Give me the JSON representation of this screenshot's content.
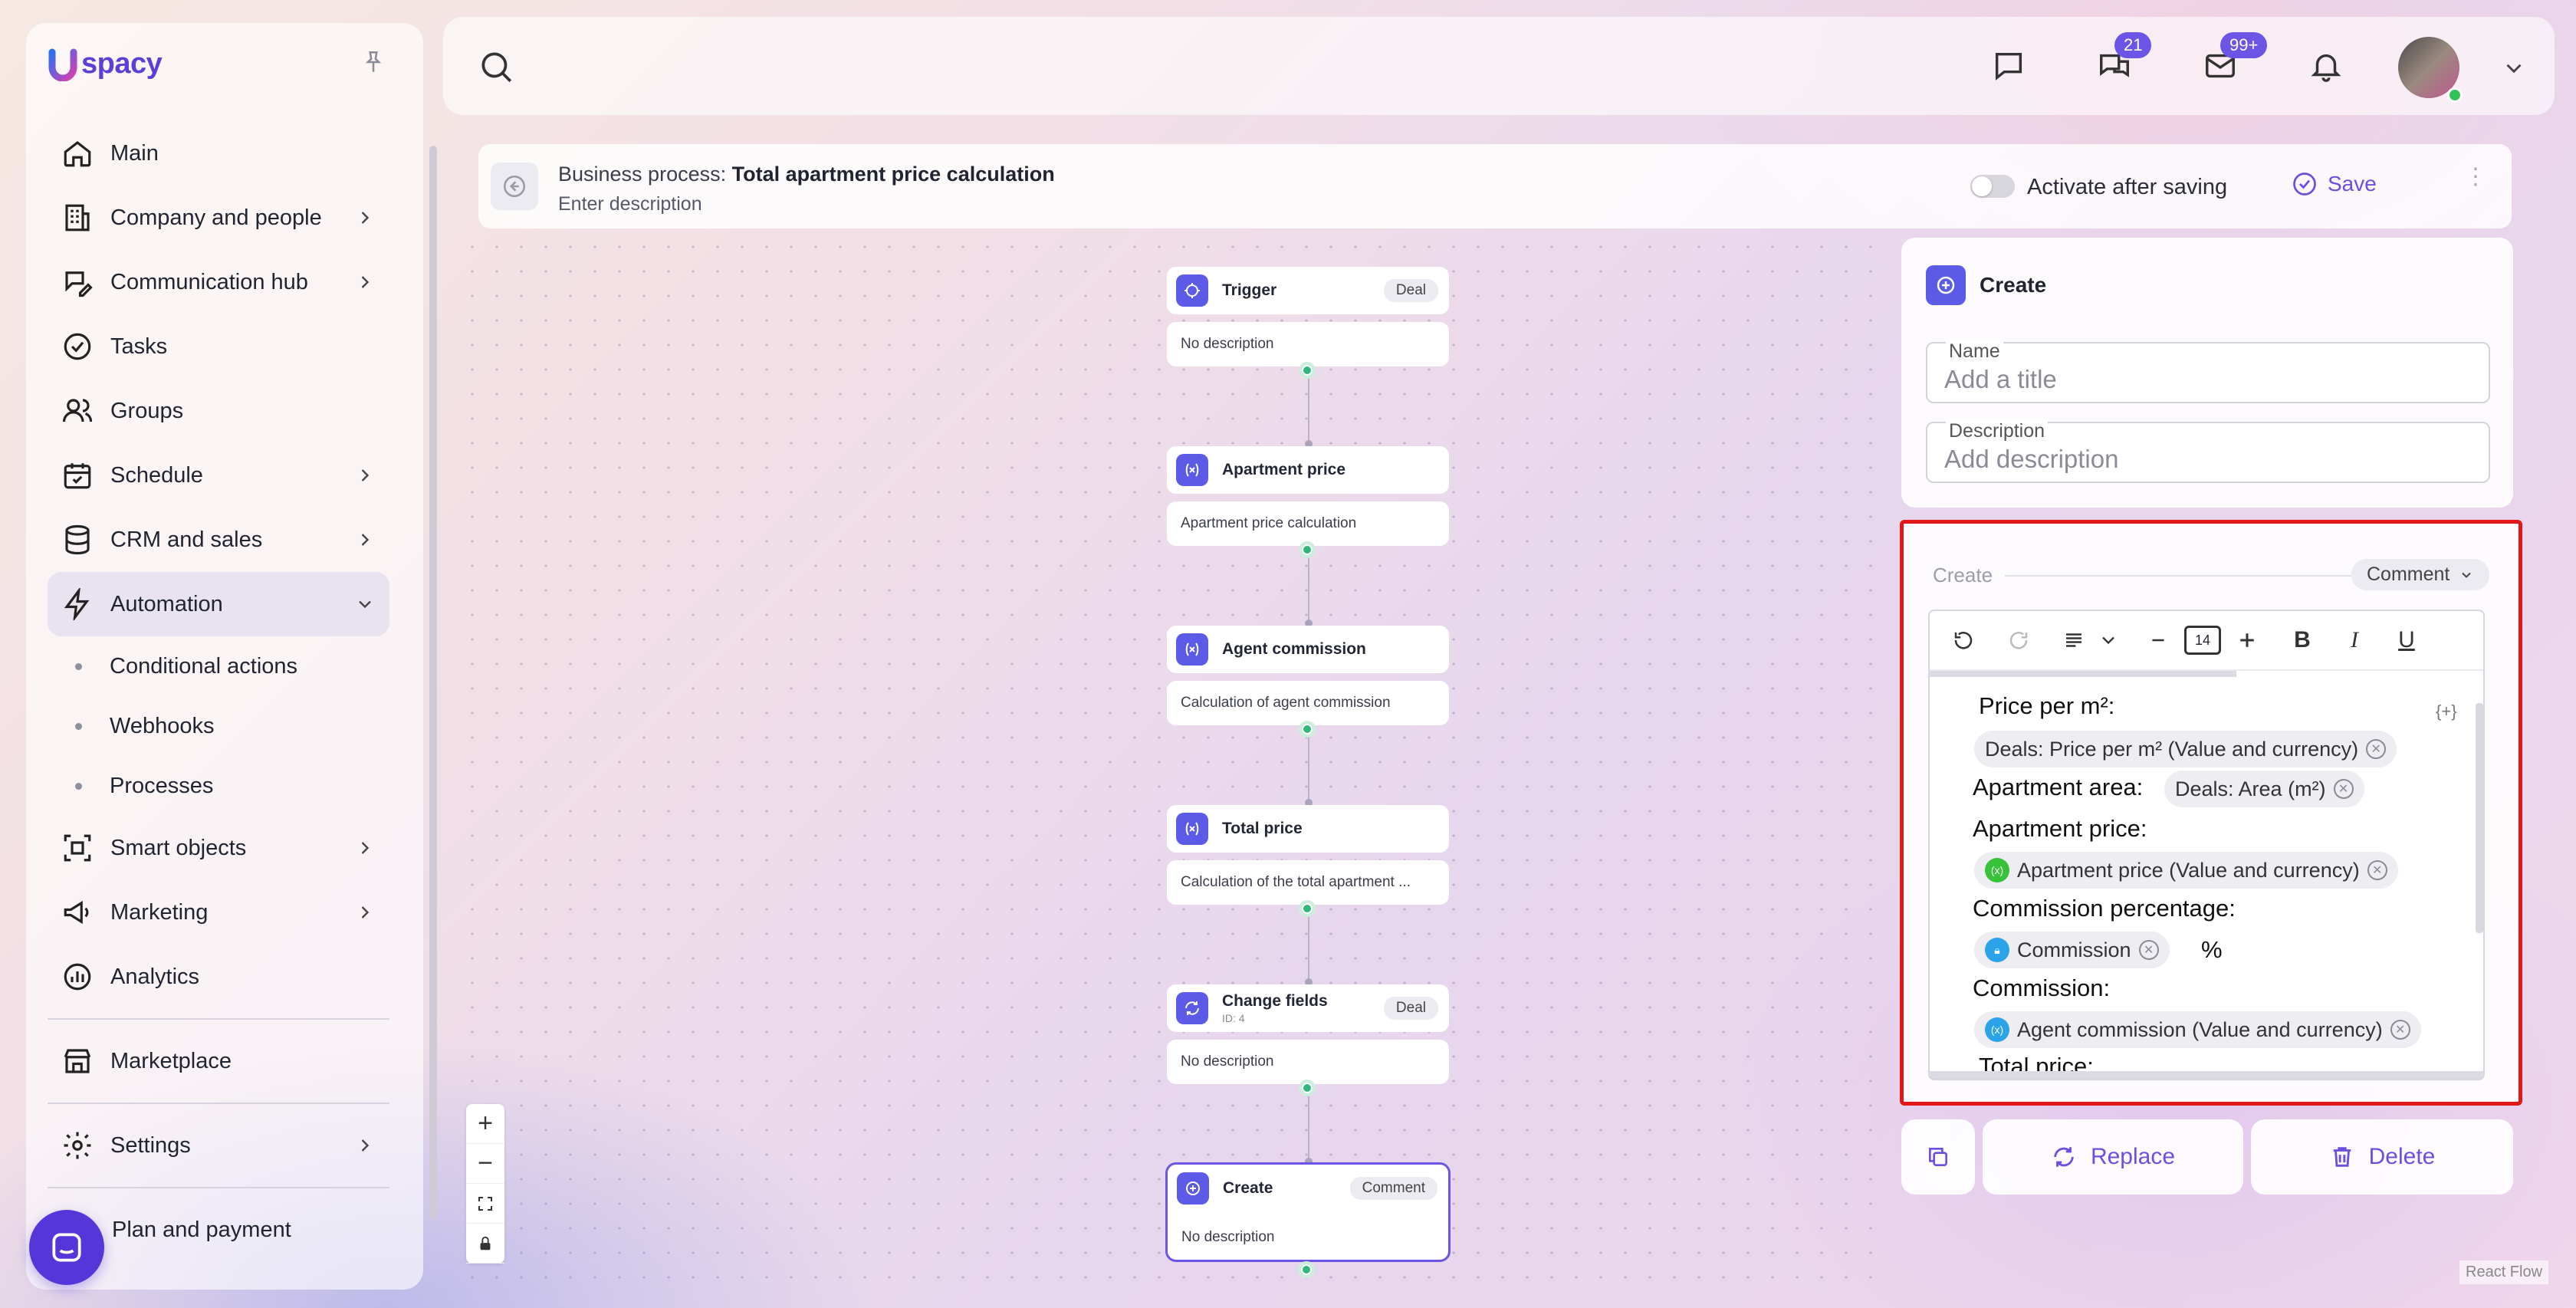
{
  "brand": {
    "name": "spacy",
    "accent": "#5b3fd6"
  },
  "sidebar": {
    "items": [
      {
        "label": "Main",
        "icon": "home-icon",
        "has_submenu": false
      },
      {
        "label": "Company and people",
        "icon": "building-icon",
        "has_submenu": true
      },
      {
        "label": "Communication hub",
        "icon": "chat-edit-icon",
        "has_submenu": true
      },
      {
        "label": "Tasks",
        "icon": "check-circle-icon",
        "has_submenu": false
      },
      {
        "label": "Groups",
        "icon": "users-icon",
        "has_submenu": false
      },
      {
        "label": "Schedule",
        "icon": "calendar-icon",
        "has_submenu": true
      },
      {
        "label": "CRM and sales",
        "icon": "database-icon",
        "has_submenu": true
      },
      {
        "label": "Automation",
        "icon": "lightning-icon",
        "has_submenu": true,
        "expanded": true
      }
    ],
    "automation_sub": [
      "Conditional actions",
      "Webhooks",
      "Processes"
    ],
    "items2": [
      {
        "label": "Smart objects",
        "icon": "scan-icon",
        "has_submenu": true
      },
      {
        "label": "Marketing",
        "icon": "megaphone-icon",
        "has_submenu": true
      },
      {
        "label": "Analytics",
        "icon": "chart-icon",
        "has_submenu": false
      }
    ],
    "marketplace": "Marketplace",
    "settings": "Settings",
    "plan": "Plan and payment"
  },
  "topbar": {
    "chat_badge": "21",
    "mail_badge": "99+"
  },
  "process": {
    "prefix": "Business process:",
    "name": "Total apartment price calculation",
    "description": "Enter description",
    "activate_label": "Activate after saving",
    "activate_on": false,
    "save_label": "Save"
  },
  "nodes": [
    {
      "title": "Trigger",
      "tag": "Deal",
      "body": "No description",
      "icon": "trigger-icon"
    },
    {
      "title": "Apartment price",
      "body": "Apartment price calculation",
      "icon": "variable-icon"
    },
    {
      "title": "Agent commission",
      "body": "Calculation of agent commission",
      "icon": "variable-icon"
    },
    {
      "title": "Total price",
      "body": "Calculation of the total apartment ...",
      "icon": "variable-icon"
    },
    {
      "title": "Change fields",
      "sub": "ID: 4",
      "tag": "Deal",
      "body": "No description",
      "icon": "refresh-icon"
    },
    {
      "title": "Create",
      "tag": "Comment",
      "body": "No description",
      "icon": "plus-circle-icon",
      "selected": true
    }
  ],
  "panel": {
    "title": "Create",
    "name_label": "Name",
    "name_placeholder": "Add a title",
    "desc_label": "Description",
    "desc_placeholder": "Add description",
    "section_label": "Create",
    "entity_type": "Comment",
    "font_size": "14",
    "var_button": "{+}",
    "content": {
      "price_m2_label": "Price per m²:",
      "price_m2_chip": "Deals: Price per m² (Value and currency)",
      "area_label": "Apartment area:",
      "area_chip": "Deals: Area (m²)",
      "apt_price_label": "Apartment price:",
      "apt_price_chip": "Apartment price (Value and currency)",
      "commission_pct_label": "Commission percentage:",
      "commission_pct_chip": "Commission",
      "percent": "%",
      "commission_label": "Commission:",
      "commission_chip": "Agent commission (Value and currency)",
      "total_label": "Total price:"
    },
    "replace_label": "Replace",
    "delete_label": "Delete"
  },
  "footer": {
    "react_flow": "React Flow"
  }
}
